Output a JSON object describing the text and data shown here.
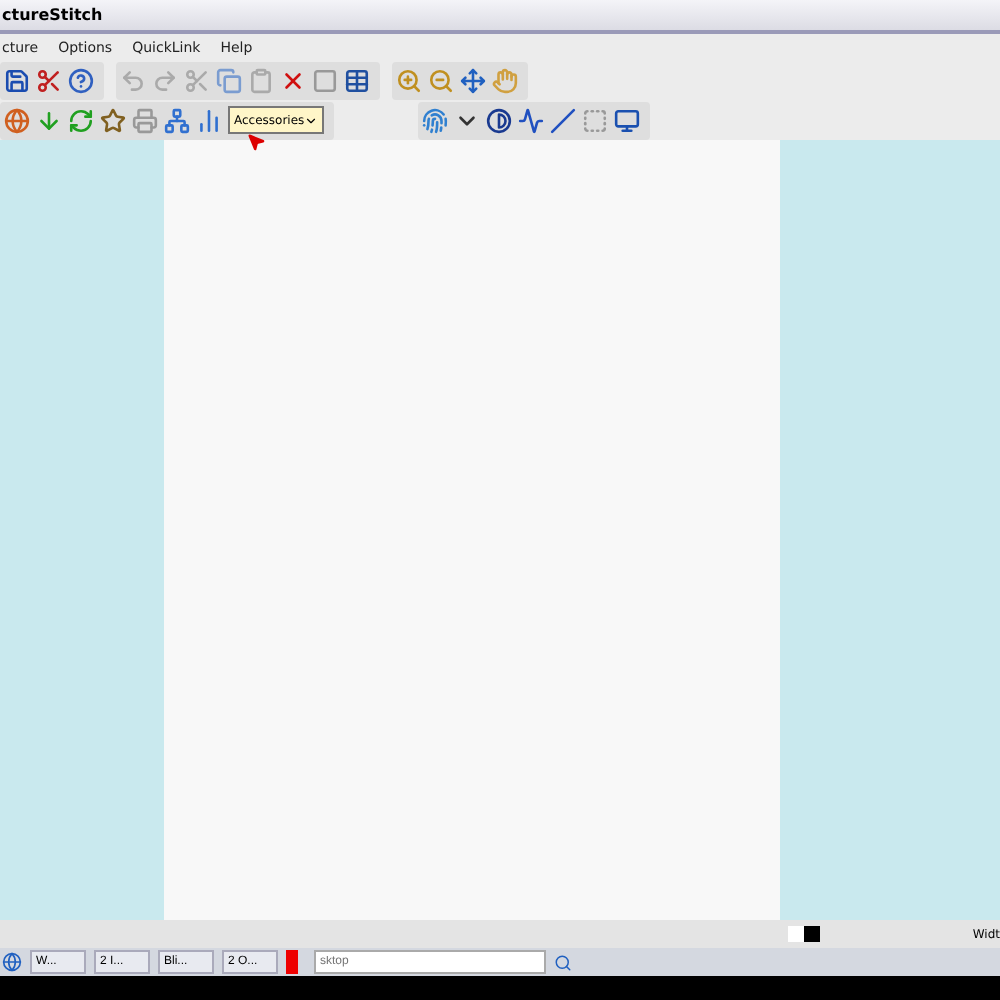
{
  "window": {
    "title": "ctureStitch"
  },
  "menu": [
    {
      "label": "cture"
    },
    {
      "label": "Options"
    },
    {
      "label": "QuickLink"
    },
    {
      "label": "Help"
    }
  ],
  "toolbar": {
    "dropdown": {
      "value": "Accessories"
    }
  },
  "status_bar": {
    "text": "Widt"
  },
  "taskbar": {
    "buttons": [
      {
        "label": "W..."
      },
      {
        "label": "2 I..."
      },
      {
        "label": "Bli..."
      },
      {
        "label": "2 O..."
      }
    ],
    "search": {
      "placeholder": "sktop"
    }
  }
}
